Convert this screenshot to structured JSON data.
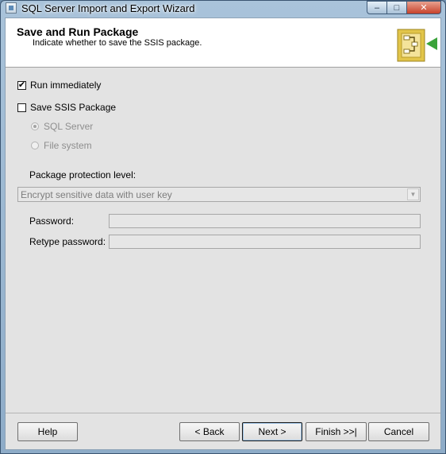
{
  "window": {
    "title": "SQL Server Import and Export Wizard",
    "controls": {
      "minimize": "–",
      "maximize": "□",
      "close": "✕"
    }
  },
  "header": {
    "title": "Save and Run Package",
    "subtitle": "Indicate whether to save the SSIS package.",
    "art_icon": "package-wizard-icon"
  },
  "options": {
    "run_immediately": {
      "label": "Run immediately",
      "checked": true,
      "mark": "✔"
    },
    "save_ssis_package": {
      "label": "Save SSIS Package",
      "checked": false
    },
    "sql_server": {
      "label": "SQL Server",
      "selected": true
    },
    "file_system": {
      "label": "File system",
      "selected": false
    }
  },
  "protection": {
    "label": "Package protection level:",
    "selected": "Encrypt sensitive data with user key",
    "arrow": "▼"
  },
  "password": {
    "label": "Password:",
    "value": ""
  },
  "retype_password": {
    "label": "Retype password:",
    "value": ""
  },
  "buttons": {
    "help": "Help",
    "back": "< Back",
    "next": "Next >",
    "finish": "Finish >>|",
    "cancel": "Cancel"
  },
  "colors": {
    "title_bar": "#a9c3da",
    "panel": "#e3e3e3",
    "accent_green": "#3aa33a",
    "package_gold": "#e2c54a"
  }
}
